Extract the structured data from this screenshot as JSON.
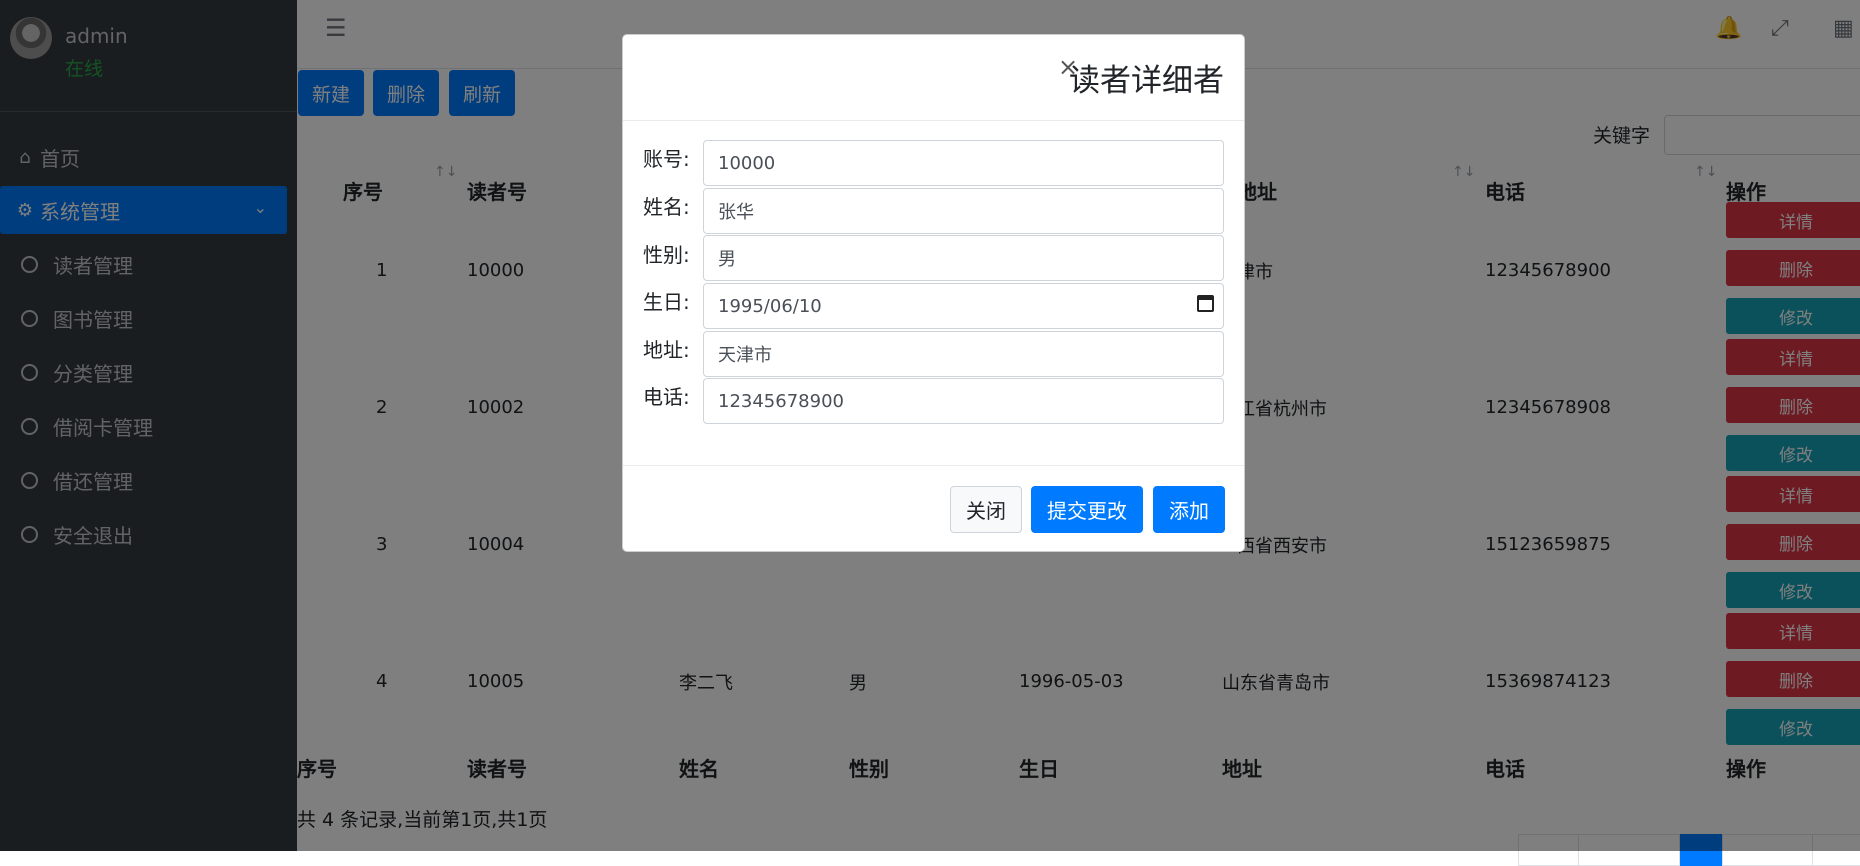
{
  "sidebar": {
    "user": {
      "name": "admin",
      "status": "在线"
    },
    "items": [
      {
        "label": "首页",
        "icon": "home-icon"
      },
      {
        "label": "系统管理",
        "icon": "gear-icon"
      },
      {
        "label": "读者管理"
      },
      {
        "label": "图书管理"
      },
      {
        "label": "分类管理"
      },
      {
        "label": "借阅卡管理"
      },
      {
        "label": "借还管理"
      },
      {
        "label": "安全退出"
      }
    ]
  },
  "topbar": {
    "icons": [
      "menu-icon",
      "bell-icon",
      "expand-icon",
      "grid-icon"
    ]
  },
  "toolbar": {
    "new_label": "新建",
    "delete_label": "删除",
    "refresh_label": "刷新",
    "keyword_label": "关键字"
  },
  "table": {
    "headers": [
      "序号",
      "读者号",
      "姓名",
      "性别",
      "生日",
      "地址",
      "电话",
      "操作"
    ],
    "rows": [
      {
        "no": "1",
        "reader": "10000",
        "name": "",
        "gender": "",
        "birthday": "",
        "address": "津市",
        "phone": "12345678900"
      },
      {
        "no": "2",
        "reader": "10002",
        "name": "",
        "gender": "",
        "birthday": "",
        "address": "江省杭州市",
        "phone": "12345678908"
      },
      {
        "no": "3",
        "reader": "10004",
        "name": "",
        "gender": "",
        "birthday": "",
        "address": "西省西安市",
        "phone": "15123659875"
      },
      {
        "no": "4",
        "reader": "10005",
        "name": "李二飞",
        "gender": "男",
        "birthday": "1996-05-03",
        "address": "山东省青岛市",
        "phone": "15369874123"
      }
    ],
    "actions": {
      "detail": "详情",
      "delete": "删除",
      "edit": "修改"
    },
    "footer_info": "共 4 条记录,当前第1页,共1页"
  },
  "modal": {
    "title": "读者详细者",
    "close_symbol": "×",
    "fields": [
      {
        "label": "账号:",
        "value": "10000"
      },
      {
        "label": "姓名:",
        "value": "张华"
      },
      {
        "label": "性别:",
        "value": "男"
      },
      {
        "label": "生日:",
        "value": "1995/06/10"
      },
      {
        "label": "地址:",
        "value": "天津市"
      },
      {
        "label": "电话:",
        "value": "12345678900"
      }
    ],
    "buttons": {
      "close": "关闭",
      "submit": "提交更改",
      "add": "添加"
    }
  },
  "colors": {
    "sidebar_bg": "#343a40",
    "primary": "#007bff",
    "danger": "#dc3545",
    "info": "#17a2b8",
    "online": "#28a745"
  }
}
